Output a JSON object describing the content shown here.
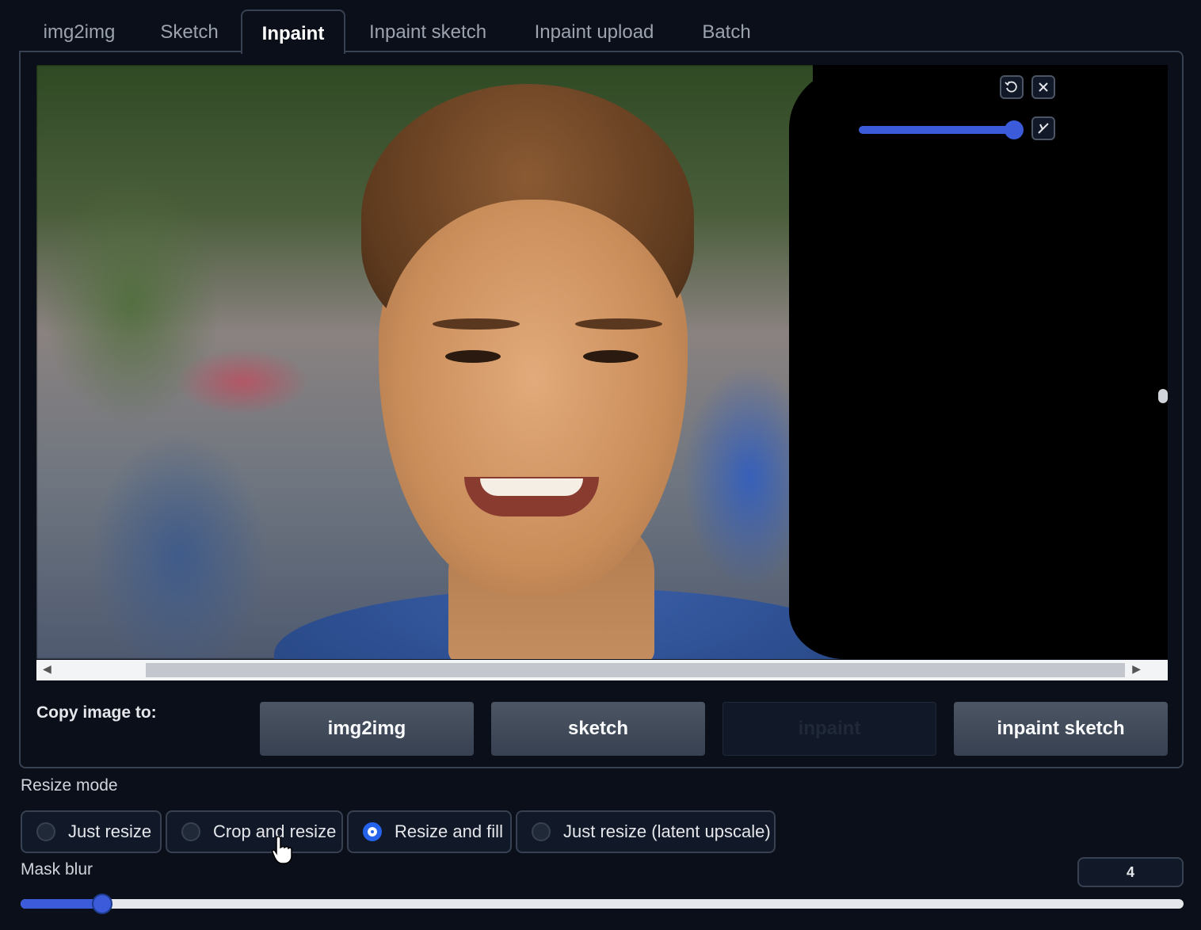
{
  "tabs": [
    {
      "label": "img2img"
    },
    {
      "label": "Sketch"
    },
    {
      "label": "Inpaint",
      "active": true
    },
    {
      "label": "Inpaint sketch"
    },
    {
      "label": "Inpaint upload"
    },
    {
      "label": "Batch"
    }
  ],
  "canvas": {
    "undo_icon": "undo-icon",
    "clear_icon": "close-icon",
    "brush_icon": "brush-icon",
    "brush_size_fraction": 0.95
  },
  "copy_image": {
    "label": "Copy image to:",
    "buttons": [
      "img2img",
      "sketch",
      "inpaint",
      "inpaint sketch"
    ]
  },
  "resize_mode": {
    "label": "Resize mode",
    "options": [
      "Just resize",
      "Crop and resize",
      "Resize and fill",
      "Just resize (latent upscale)"
    ],
    "selected": "Resize and fill"
  },
  "mask_blur": {
    "label": "Mask blur",
    "value": "4",
    "fraction": 0.07
  },
  "colors": {
    "background": "#0b0f19",
    "accent": "#3b5bdb",
    "button": "#374151"
  }
}
